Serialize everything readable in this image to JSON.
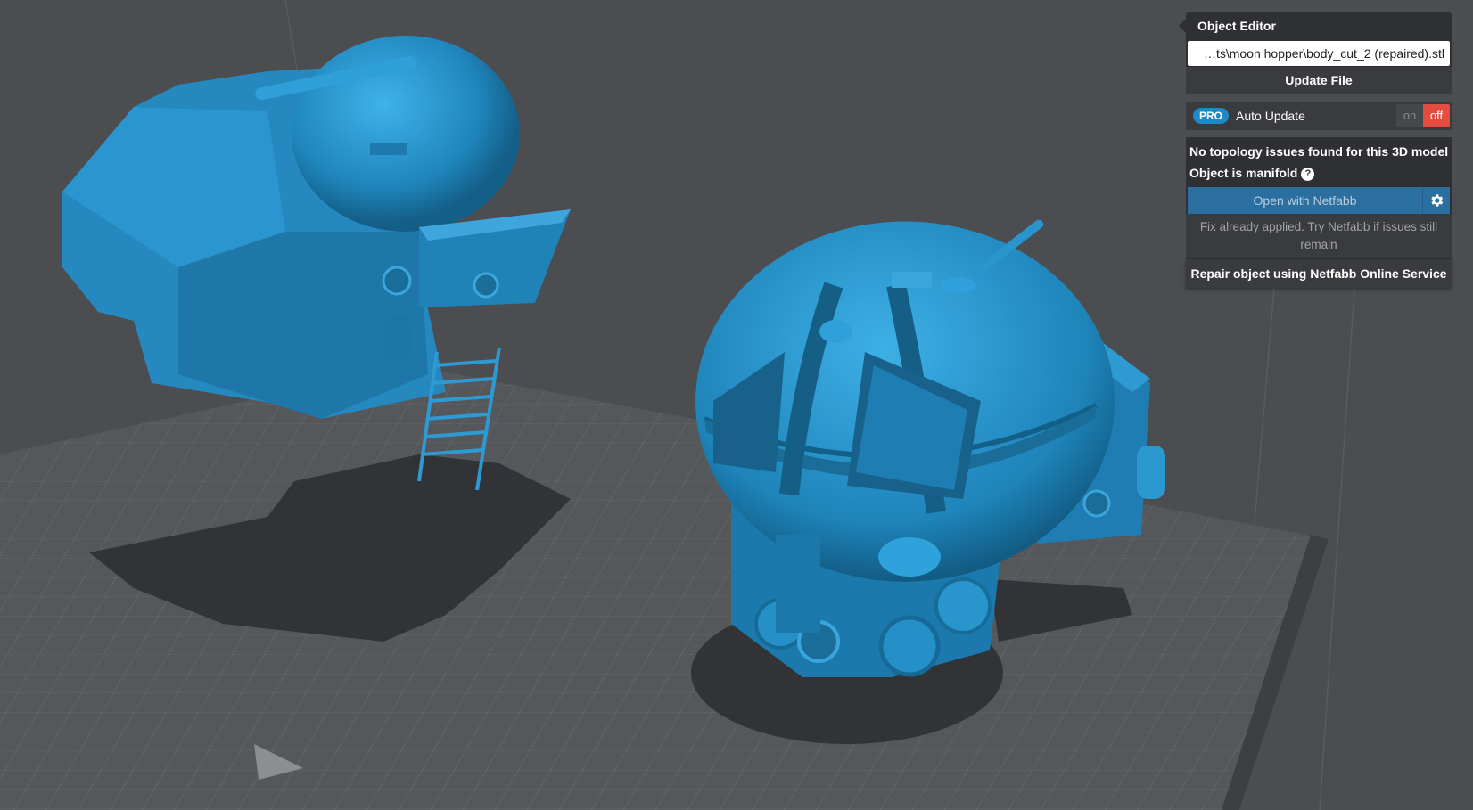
{
  "object_editor": {
    "title": "Object Editor",
    "file_path": "…ts\\moon hopper\\body_cut_2 (repaired).stl",
    "update_file_label": "Update File",
    "pro_badge": "PRO",
    "auto_update_label": "Auto Update",
    "toggle_on_label": "on",
    "toggle_off_label": "off",
    "toggle_state": "off",
    "topology_status": "No topology issues found for this 3D model",
    "manifold_status": "Object is manifold",
    "help_glyph": "?",
    "open_netfabb_label": "Open with Netfabb",
    "fix_note": "Fix already applied. Try Netfabb if issues still remain",
    "repair_label": "Repair object using Netfabb Online Service"
  },
  "colors": {
    "background": "#4b4d51",
    "model_blue": "#2790c7",
    "toggle_off_red": "#e44c3e",
    "pro_blue": "#1e88c9",
    "netfabb_blue": "#2a6fa0"
  },
  "icons": {
    "gear": "gear-icon",
    "help": "help-icon"
  }
}
